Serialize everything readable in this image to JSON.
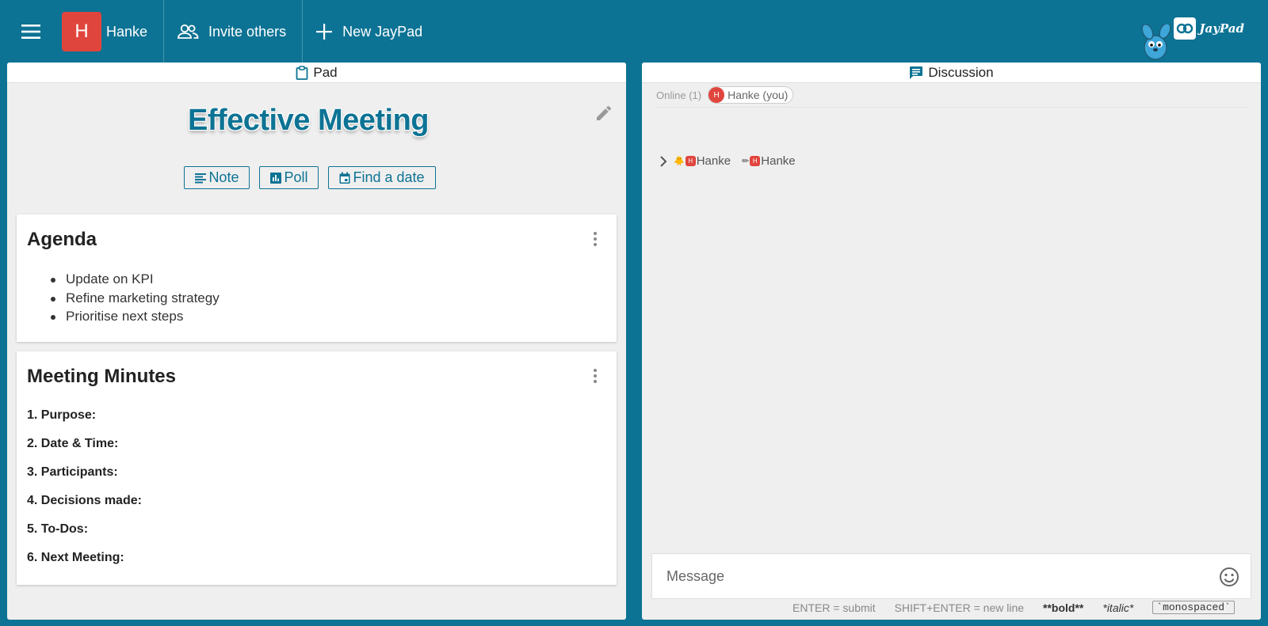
{
  "topbar": {
    "menu_icon": "hamburger-menu-icon",
    "user_initial": "H",
    "user_name": "Hanke",
    "invite_label": "Invite others",
    "new_label": "New JayPad",
    "brand_text": "JayPad",
    "accent": "#0d7394",
    "avatar_color": "#e0453d"
  },
  "pad": {
    "header": "Pad",
    "title": "Effective Meeting",
    "tools": [
      {
        "label": "Note",
        "icon": "note-icon"
      },
      {
        "label": "Poll",
        "icon": "poll-icon"
      },
      {
        "label": "Find a date",
        "icon": "calendar-icon"
      }
    ],
    "agenda": {
      "title": "Agenda",
      "items": [
        "Update on KPI",
        "Refine marketing strategy",
        "Prioritise next steps"
      ]
    },
    "minutes": {
      "title": "Meeting Minutes",
      "items": [
        "1. Purpose:",
        "2. Date & Time:",
        "3. Participants:",
        "4. Decisions made:",
        "5. To-Dos:",
        "6. Next Meeting:"
      ]
    }
  },
  "discussion": {
    "header": "Discussion",
    "online_label": "Online (1)",
    "online_initial": "H",
    "online_user": "Hanke (you)",
    "activity": [
      {
        "emoji": "🐥",
        "initial": "H",
        "name": "Hanke"
      },
      {
        "emoji": "✏",
        "initial": "H",
        "name": "Hanke"
      }
    ],
    "message_placeholder": "Message",
    "hints": {
      "submit": "ENTER = submit",
      "newline": "SHIFT+ENTER = new line",
      "bold": "**bold**",
      "italic": "*italic*",
      "mono": "`monospaced`"
    }
  }
}
